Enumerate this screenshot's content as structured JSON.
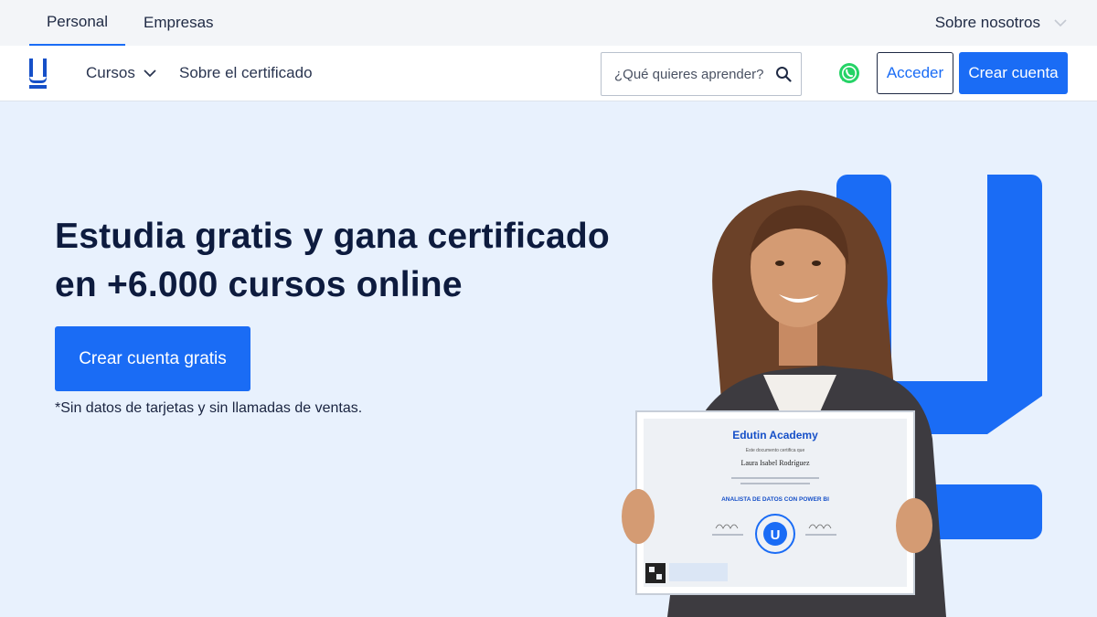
{
  "topbar": {
    "tabs": [
      {
        "label": "Personal",
        "active": true
      },
      {
        "label": "Empresas",
        "active": false
      }
    ],
    "about_label": "Sobre nosotros",
    "about_icon": "chevron-down-icon"
  },
  "navbar": {
    "logo_icon": "edutin-u-logo",
    "links": [
      {
        "label": "Cursos",
        "icon": "chevron-down-icon"
      },
      {
        "label": "Sobre el certificado"
      }
    ],
    "search": {
      "placeholder": "¿Qué quieres aprender?",
      "value": "",
      "icon": "search-icon"
    },
    "whatsapp_icon": "whatsapp-icon",
    "login_label": "Acceder",
    "signup_label": "Crear cuenta"
  },
  "hero": {
    "title_line1": "Estudia gratis y gana certificado",
    "title_line2": "en +6.000 cursos online",
    "cta_label": "Crear cuenta gratis",
    "disclaimer": "*Sin datos de tarjetas y sin llamadas de ventas."
  },
  "certificate": {
    "academy": "Edutin Academy",
    "line1": "Este documento certifica que",
    "student": "Laura Isabel Rodríguez",
    "course": "ANALISTA DE DATOS CON POWER BI"
  },
  "colors": {
    "accent": "#1a6cf5",
    "hero_bg": "#e8f1fd",
    "text_dark": "#0d1b3e"
  }
}
